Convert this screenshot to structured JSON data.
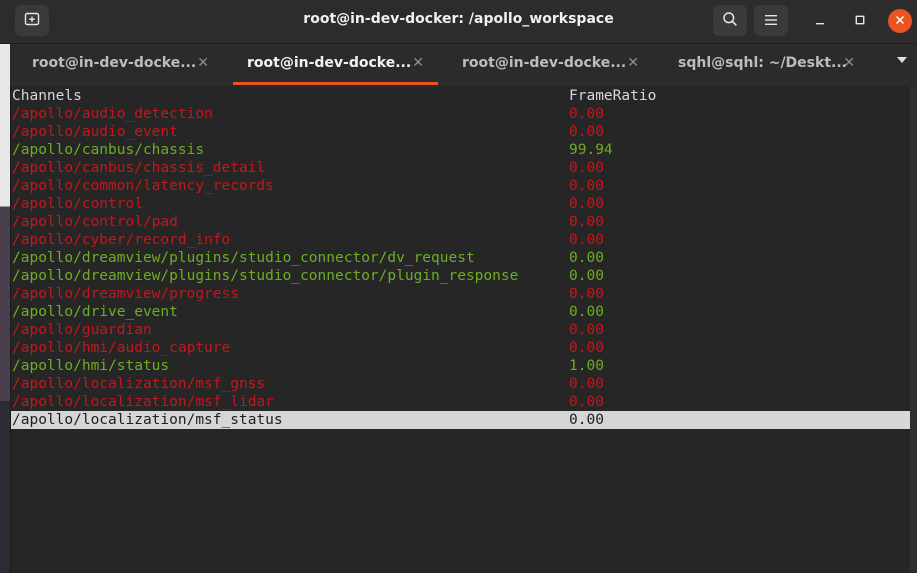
{
  "window": {
    "title": "root@in-dev-docker: /apollo_workspace"
  },
  "tabs": [
    {
      "label": "root@in-dev-docke...",
      "active": false
    },
    {
      "label": "root@in-dev-docke...",
      "active": true
    },
    {
      "label": "root@in-dev-docke...",
      "active": false
    },
    {
      "label": "sqhl@sqhl: ~/Deskt...",
      "active": false
    }
  ],
  "table": {
    "headers": {
      "channels": "Channels",
      "frame_ratio": "FrameRatio"
    },
    "rows": [
      {
        "channel": "/apollo/audio_detection",
        "ratio": "0.00",
        "status": "red"
      },
      {
        "channel": "/apollo/audio_event",
        "ratio": "0.00",
        "status": "red"
      },
      {
        "channel": "/apollo/canbus/chassis",
        "ratio": "99.94",
        "status": "green"
      },
      {
        "channel": "/apollo/canbus/chassis_detail",
        "ratio": "0.00",
        "status": "red"
      },
      {
        "channel": "/apollo/common/latency_records",
        "ratio": "0.00",
        "status": "red"
      },
      {
        "channel": "/apollo/control",
        "ratio": "0.00",
        "status": "red"
      },
      {
        "channel": "/apollo/control/pad",
        "ratio": "0.00",
        "status": "red"
      },
      {
        "channel": "/apollo/cyber/record_info",
        "ratio": "0.00",
        "status": "red"
      },
      {
        "channel": "/apollo/dreamview/plugins/studio_connector/dv_request",
        "ratio": "0.00",
        "status": "green"
      },
      {
        "channel": "/apollo/dreamview/plugins/studio_connector/plugin_response",
        "ratio": "0.00",
        "status": "green"
      },
      {
        "channel": "/apollo/dreamview/progress",
        "ratio": "0.00",
        "status": "red"
      },
      {
        "channel": "/apollo/drive_event",
        "ratio": "0.00",
        "status": "green"
      },
      {
        "channel": "/apollo/guardian",
        "ratio": "0.00",
        "status": "red"
      },
      {
        "channel": "/apollo/hmi/audio_capture",
        "ratio": "0.00",
        "status": "red"
      },
      {
        "channel": "/apollo/hmi/status",
        "ratio": "1.00",
        "status": "green"
      },
      {
        "channel": "/apollo/localization/msf_gnss",
        "ratio": "0.00",
        "status": "red"
      },
      {
        "channel": "/apollo/localization/msf_lidar",
        "ratio": "0.00",
        "status": "red"
      },
      {
        "channel": "/apollo/localization/msf_status",
        "ratio": "0.00",
        "status": "selected"
      }
    ]
  },
  "colors": {
    "accent": "#e95420",
    "green": "#6cae22",
    "red": "#c4161c",
    "selected_bg": "#d6d6d6",
    "close_button": "#e95420"
  },
  "icons": {
    "new_tab": "new-tab-icon",
    "search": "search-icon",
    "menu": "hamburger-menu-icon",
    "minimize": "minimize-icon",
    "maximize": "maximize-icon",
    "close": "close-icon"
  }
}
